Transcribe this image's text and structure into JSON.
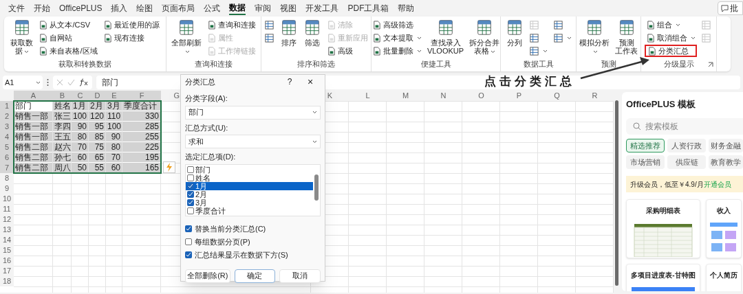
{
  "menu_tabs": [
    {
      "label": "文件",
      "selected": false
    },
    {
      "label": "开始",
      "selected": false
    },
    {
      "label": "OfficePLUS",
      "selected": false
    },
    {
      "label": "插入",
      "selected": false
    },
    {
      "label": "绘图",
      "selected": false
    },
    {
      "label": "页面布局",
      "selected": false
    },
    {
      "label": "公式",
      "selected": false
    },
    {
      "label": "数据",
      "selected": true
    },
    {
      "label": "审阅",
      "selected": false
    },
    {
      "label": "视图",
      "selected": false
    },
    {
      "label": "开发工具",
      "selected": false
    },
    {
      "label": "PDF工具箱",
      "selected": false
    },
    {
      "label": "帮助",
      "selected": false
    }
  ],
  "comment_button": {
    "label": "批"
  },
  "ribbon": {
    "groups": [
      {
        "label": "获取和转换数据",
        "items": [
          {
            "kind": "large",
            "lines": [
              "获取数",
              "据"
            ],
            "dropdown": true,
            "disabled": false
          },
          {
            "kind": "small",
            "label": "从文本/CSV",
            "dropdown": false,
            "disabled": false
          },
          {
            "kind": "small",
            "label": "自网站",
            "dropdown": false,
            "disabled": false
          },
          {
            "kind": "small",
            "label": "来自表格/区域",
            "dropdown": false,
            "disabled": false
          },
          {
            "kind": "small",
            "label": "最近使用的源",
            "dropdown": false,
            "disabled": false
          },
          {
            "kind": "small",
            "label": "现有连接",
            "dropdown": false,
            "disabled": false
          }
        ]
      },
      {
        "label": "查询和连接",
        "items": [
          {
            "kind": "large",
            "lines": [
              "全部刷新"
            ],
            "dropdown": true,
            "disabled": false
          },
          {
            "kind": "small",
            "label": "查询和连接",
            "dropdown": false,
            "disabled": false
          },
          {
            "kind": "small",
            "label": "属性",
            "dropdown": false,
            "disabled": true
          },
          {
            "kind": "small",
            "label": "工作簿链接",
            "dropdown": false,
            "disabled": true
          }
        ]
      },
      {
        "label": "排序和筛选",
        "items": [
          {
            "kind": "icon",
            "dropdown": false,
            "disabled": false
          },
          {
            "kind": "icon",
            "dropdown": false,
            "disabled": false
          },
          {
            "kind": "large",
            "lines": [
              "排序"
            ],
            "dropdown": false,
            "disabled": false
          },
          {
            "kind": "large",
            "lines": [
              "筛选"
            ],
            "dropdown": false,
            "disabled": false
          },
          {
            "kind": "small",
            "label": "清除",
            "dropdown": false,
            "disabled": true
          },
          {
            "kind": "small",
            "label": "重新应用",
            "dropdown": false,
            "disabled": true
          },
          {
            "kind": "small",
            "label": "高级",
            "dropdown": false,
            "disabled": false
          }
        ]
      },
      {
        "label": "便捷工具",
        "items": [
          {
            "kind": "small",
            "label": "高级筛选",
            "dropdown": false,
            "disabled": false
          },
          {
            "kind": "small",
            "label": "文本提取",
            "dropdown": true,
            "disabled": false
          },
          {
            "kind": "small",
            "label": "批量删除",
            "dropdown": true,
            "disabled": false
          },
          {
            "kind": "large",
            "lines": [
              "查找录入",
              "VLOOKUP"
            ],
            "dropdown": false,
            "disabled": false
          },
          {
            "kind": "large",
            "lines": [
              "拆分合并",
              "表格"
            ],
            "dropdown": true,
            "disabled": false
          }
        ]
      },
      {
        "label": "数据工具",
        "items": [
          {
            "kind": "large",
            "lines": [
              "分列"
            ],
            "dropdown": false,
            "disabled": false
          },
          {
            "kind": "icon",
            "dropdown": false,
            "disabled": true
          },
          {
            "kind": "icon",
            "dropdown": false,
            "disabled": false
          },
          {
            "kind": "icon",
            "dropdown": true,
            "disabled": false
          },
          {
            "kind": "icon",
            "dropdown": false,
            "disabled": false
          },
          {
            "kind": "icon",
            "dropdown": true,
            "disabled": false
          }
        ]
      },
      {
        "label": "预测",
        "items": [
          {
            "kind": "large",
            "lines": [
              "模拟分析"
            ],
            "dropdown": true,
            "disabled": false
          },
          {
            "kind": "large",
            "lines": [
              "预测",
              "工作表"
            ],
            "dropdown": false,
            "disabled": false
          }
        ]
      },
      {
        "label": "分级显示",
        "items": [
          {
            "kind": "small",
            "label": "组合",
            "dropdown": true,
            "disabled": false
          },
          {
            "kind": "small",
            "label": "取消组合",
            "dropdown": true,
            "disabled": false
          },
          {
            "kind": "small",
            "label": "分类汇总",
            "dropdown": false,
            "disabled": false,
            "highlighted": true
          },
          {
            "kind": "icon",
            "dropdown": false,
            "disabled": true
          },
          {
            "kind": "icon",
            "dropdown": false,
            "disabled": true
          }
        ]
      }
    ]
  },
  "name_box": "A1",
  "formula": "部门",
  "annotation": "点击分类汇总",
  "grid": {
    "columns": [
      "A",
      "B",
      "C",
      "D",
      "E",
      "F",
      "G",
      "K",
      "L",
      "M",
      "N",
      "O",
      "P",
      "Q",
      "R"
    ],
    "rows": [
      "1",
      "2",
      "3",
      "4",
      "5",
      "6",
      "7",
      "8",
      "9",
      "10",
      "11",
      "12",
      "13",
      "14",
      "15",
      "16",
      "17",
      "18"
    ],
    "range_selected": true,
    "cells": [
      [
        "部门",
        "姓名",
        "1月",
        "2月",
        "3月",
        "季度合计"
      ],
      [
        "销售一部",
        "张三",
        "100",
        "120",
        "110",
        "330"
      ],
      [
        "销售一部",
        "李四",
        "90",
        "95",
        "100",
        "285"
      ],
      [
        "销售一部",
        "王五",
        "80",
        "85",
        "90",
        "255"
      ],
      [
        "销售二部",
        "赵六",
        "70",
        "75",
        "80",
        "225"
      ],
      [
        "销售二部",
        "孙七",
        "60",
        "65",
        "70",
        "195"
      ],
      [
        "销售二部",
        "周八",
        "50",
        "55",
        "60",
        "165"
      ]
    ]
  },
  "dialog": {
    "title": "分类汇总",
    "help": "?",
    "close": "×",
    "field_label": "分类字段(A):",
    "field_value": "部门",
    "method_label": "汇总方式(U):",
    "method_value": "求和",
    "items_label": "选定汇总项(D):",
    "items": [
      {
        "label": "部门",
        "checked": false,
        "selected": false
      },
      {
        "label": "姓名",
        "checked": false,
        "selected": false
      },
      {
        "label": "1月",
        "checked": true,
        "selected": true
      },
      {
        "label": "2月",
        "checked": true,
        "selected": false
      },
      {
        "label": "3月",
        "checked": true,
        "selected": false
      },
      {
        "label": "季度合计",
        "checked": false,
        "selected": false
      }
    ],
    "options": [
      {
        "label": "替换当前分类汇总(C)",
        "checked": true
      },
      {
        "label": "每组数据分页(P)",
        "checked": false
      },
      {
        "label": "汇总结果显示在数据下方(S)",
        "checked": true
      }
    ],
    "buttons": [
      {
        "label": "全部删除(R)",
        "default": false
      },
      {
        "label": "确定",
        "default": true
      },
      {
        "label": "取消",
        "default": false
      }
    ]
  },
  "pane": {
    "title": "OfficePLUS 模板",
    "search_placeholder": "搜索模板",
    "tags": [
      {
        "label": "精选推荐",
        "selected": true
      },
      {
        "label": "人资行政",
        "selected": false
      },
      {
        "label": "财务金融",
        "selected": false
      },
      {
        "label": "市场营销",
        "selected": false
      },
      {
        "label": "供应链",
        "selected": false
      },
      {
        "label": "教育教学",
        "selected": false
      }
    ],
    "banner": "升级会员，低至￥4.9/月",
    "banner_link": "开通会员",
    "templates": [
      {
        "title": "采购明细表"
      },
      {
        "title": "收入"
      },
      {
        "title": "多项目进度表-甘特图"
      },
      {
        "title": "个人简历"
      }
    ]
  }
}
